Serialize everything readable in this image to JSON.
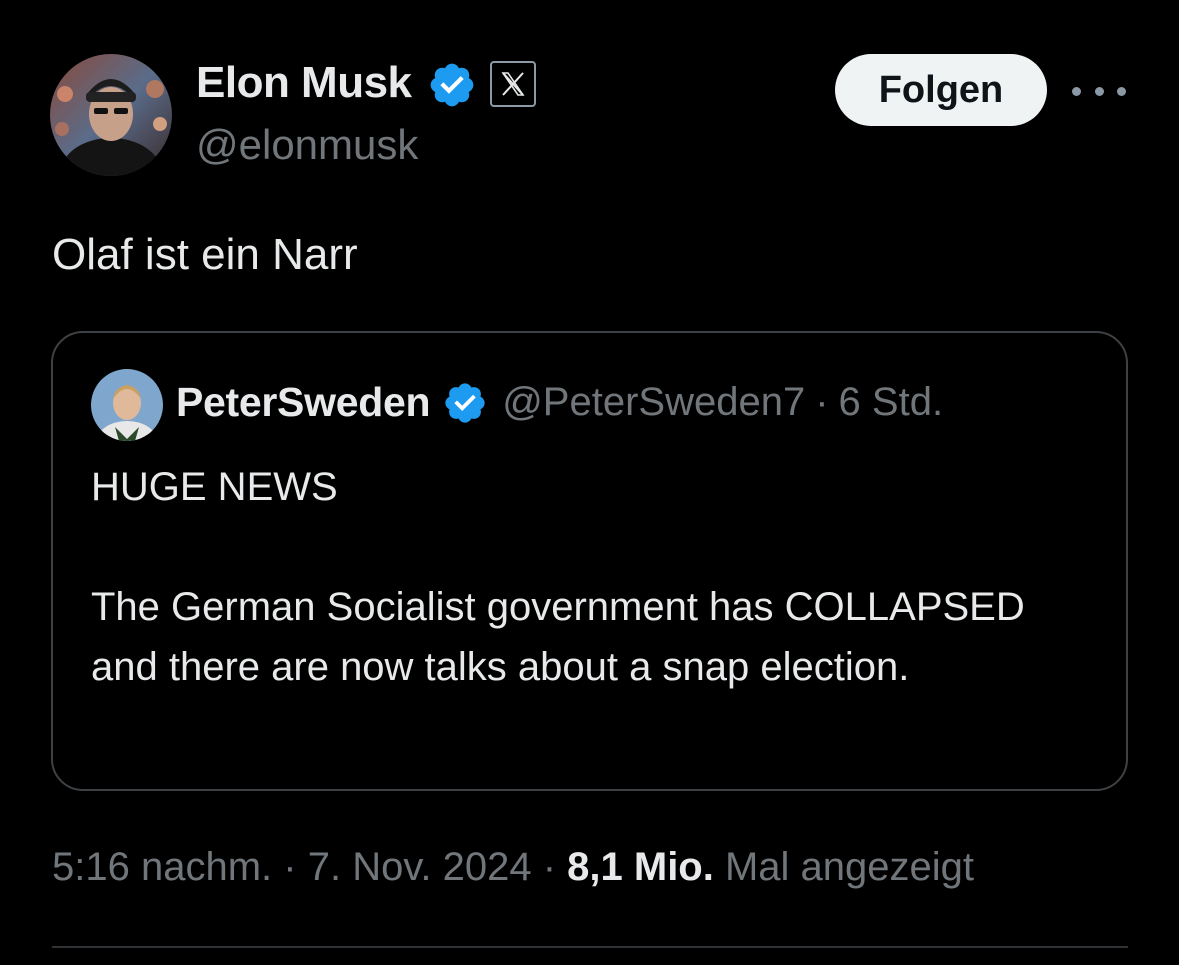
{
  "tweet": {
    "author": {
      "name": "Elon Musk",
      "handle": "@elonmusk",
      "verified": true,
      "affiliation_icon": "x-logo-icon"
    },
    "follow_label": "Folgen",
    "more_icon": "more-dots-icon",
    "text": "Olaf ist ein Narr",
    "quoted": {
      "author_name": "PeterSweden",
      "handle": "@PeterSweden7",
      "separator": "·",
      "time": "6 Std.",
      "verified": true,
      "line1": "HUGE NEWS",
      "line2": "The German Socialist government has COLLAPSED and there are now talks about a snap election."
    },
    "meta": {
      "time": "5:16 nachm.",
      "sep1": "·",
      "date": "7. Nov. 2024",
      "sep2": "·",
      "views_count": "8,1 Mio.",
      "views_label": "Mal angezeigt"
    }
  },
  "colors": {
    "background": "#000000",
    "text": "#e7e9ea",
    "secondary": "#71767b",
    "verified_blue": "#1d9bf0",
    "follow_bg": "#eff3f4",
    "border": "#3e4144"
  }
}
